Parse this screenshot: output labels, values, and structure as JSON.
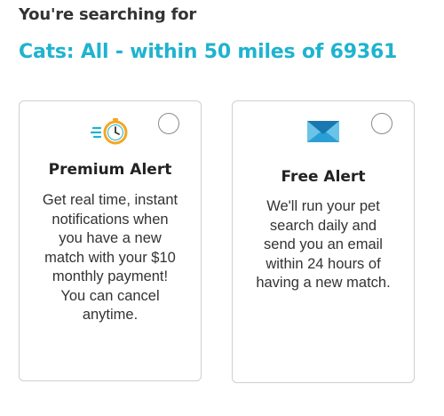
{
  "search": {
    "heading": "You're searching for",
    "criteria": "Cats: All - within 50 miles of 69361"
  },
  "alerts": {
    "premium": {
      "icon": "fast-clock-icon",
      "title": "Premium Alert",
      "description": "Get real time, instant notifications when you have a new match with your $10 monthly payment! You can cancel anytime.",
      "selected": false
    },
    "free": {
      "icon": "envelope-icon",
      "title": "Free Alert",
      "description": "We'll run your pet search daily and send you an email within 24 hours of having a new match.",
      "selected": false
    }
  },
  "colors": {
    "accent": "#1fb3cf",
    "clock_orange": "#f5a623",
    "envelope_blue": "#2a9fd6"
  }
}
